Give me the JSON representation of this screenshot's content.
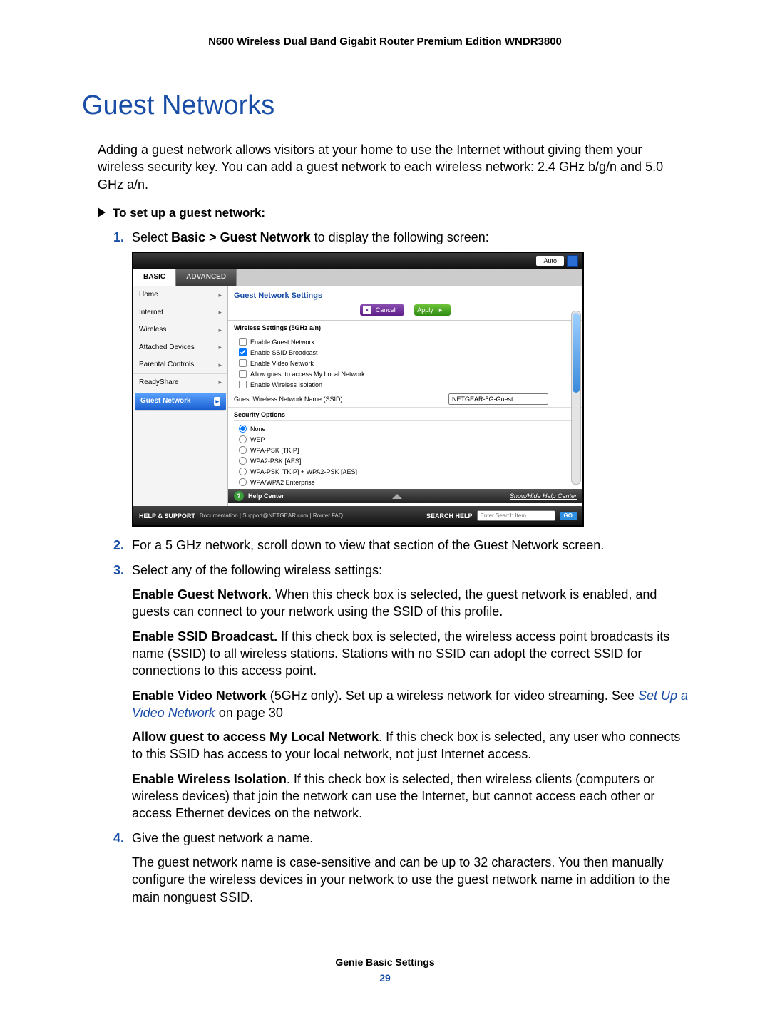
{
  "doc_header": "N600 Wireless Dual Band Gigabit Router Premium Edition WNDR3800",
  "title": "Guest Networks",
  "intro": "Adding a guest network allows visitors at your home to use the Internet without giving them your wireless security key. You can add a guest network to each wireless network: 2.4 GHz b/g/n and 5.0 GHz a/n.",
  "proc_heading": "To set up a guest network:",
  "steps": {
    "s1_pre": "Select ",
    "s1_bold": "Basic > Guest Network",
    "s1_post": " to display the following screen:",
    "s2": "For a 5 GHz network, scroll down to view that section of the Guest Network screen.",
    "s3": "Select any of the following wireless settings:",
    "s4": "Give the guest network a name.",
    "s4_body": "The guest network name is case-sensitive and can be up to 32 characters. You then manually configure the wireless devices in your network to use the guest network name in addition to the main nonguest SSID."
  },
  "opts": {
    "egn_b": "Enable Guest Network",
    "egn_t": ". When this check box is selected, the guest network is enabled, and guests can connect to your network using the SSID of this profile.",
    "esb_b": "Enable SSID Broadcast.",
    "esb_t": " If this check box is selected, the wireless access point broadcasts its name (SSID) to all wireless stations. Stations with no SSID can adopt the correct SSID for connections to this access point.",
    "evn_b": "Enable Video Network",
    "evn_t1": " (5GHz only). Set up a wireless network for video streaming. See ",
    "evn_link": "Set Up a Video Network",
    "evn_t2": " on page 30",
    "agl_b": "Allow guest to access My Local Network",
    "agl_t": ". If this check box is selected, any user who connects to this SSID has access to your local network, not just Internet access.",
    "ewi_b": "Enable Wireless Isolation",
    "ewi_t": ". If this check box is selected, then wireless clients (computers or wireless devices) that join the network can use the Internet, but cannot access each other or access Ethernet devices on the network."
  },
  "ui": {
    "auto": "Auto",
    "tab_basic": "BASIC",
    "tab_adv": "ADVANCED",
    "side": [
      "Home",
      "Internet",
      "Wireless",
      "Attached Devices",
      "Parental Controls",
      "ReadyShare",
      "Guest Network"
    ],
    "panel_title": "Guest Network Settings",
    "btn_cancel": "Cancel",
    "btn_apply": "Apply",
    "ws_header": "Wireless Settings (5GHz a/n)",
    "cb1": "Enable Guest Network",
    "cb2": "Enable SSID Broadcast",
    "cb3": "Enable Video Network",
    "cb4": "Allow guest to access My Local Network",
    "cb5": "Enable Wireless Isolation",
    "ssid_label": "Guest Wireless Network Name (SSID) :",
    "ssid_value": "NETGEAR-5G-Guest",
    "sec_header": "Security Options",
    "r1": "None",
    "r2": "WEP",
    "r3": "WPA-PSK [TKIP]",
    "r4": "WPA2-PSK [AES]",
    "r5": "WPA-PSK [TKIP] + WPA2-PSK [AES]",
    "r6": "WPA/WPA2 Enterprise",
    "help_center": "Help Center",
    "show_hide": "Show/Hide Help Center",
    "foot_hs": "HELP & SUPPORT",
    "foot_links": "Documentation | Support@NETGEAR.com | Router FAQ",
    "foot_search": "SEARCH HELP",
    "foot_ph": "Enter Search Item",
    "foot_go": "GO"
  },
  "footer_section": "Genie Basic Settings",
  "footer_page": "29"
}
